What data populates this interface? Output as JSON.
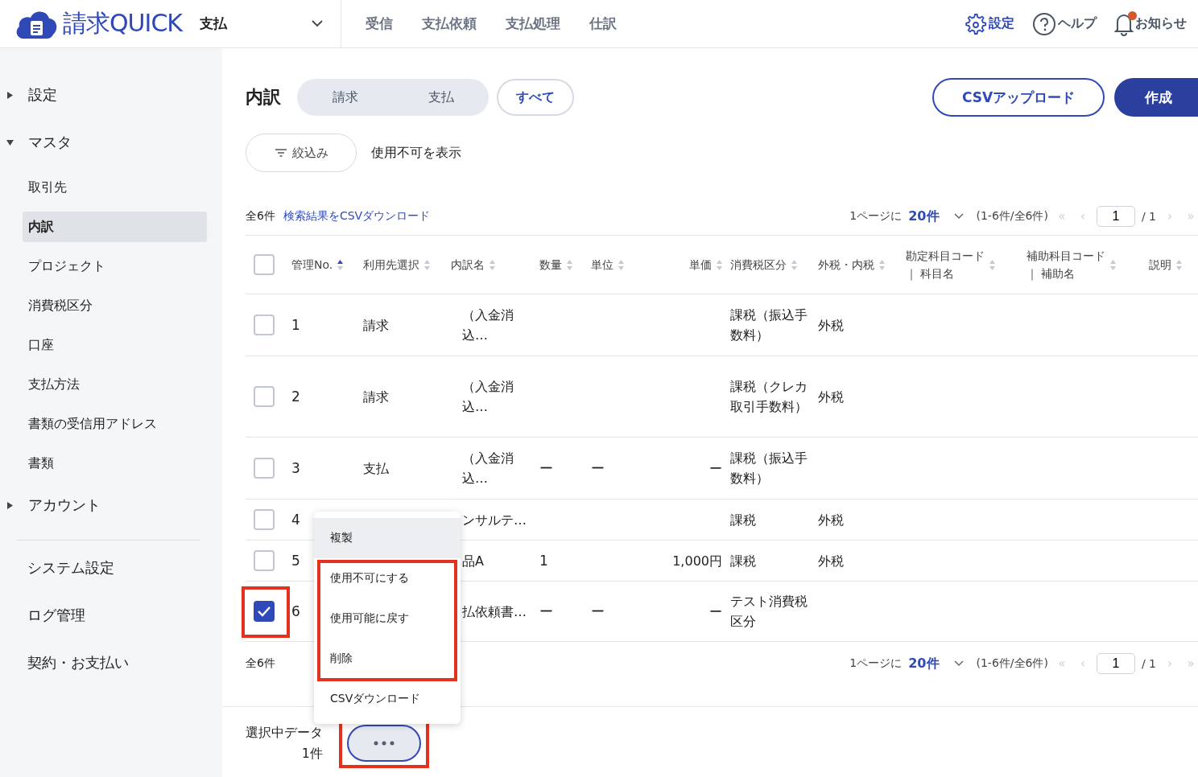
{
  "header": {
    "logo": "請求QUICK",
    "module": "支払",
    "nav": [
      {
        "label": "受信"
      },
      {
        "label": "支払依頼"
      },
      {
        "label": "支払処理"
      },
      {
        "label": "仕訳"
      }
    ],
    "settings": "設定",
    "help": "ヘルプ",
    "notifications": {
      "label": "お知らせ",
      "unread": true
    }
  },
  "sidebar": {
    "groups": [
      {
        "label": "設定",
        "expanded": false
      },
      {
        "label": "マスタ",
        "expanded": true,
        "children": [
          {
            "label": "取引先",
            "selected": false
          },
          {
            "label": "内訳",
            "selected": true
          },
          {
            "label": "プロジェクト",
            "selected": false
          },
          {
            "label": "消費税区分",
            "selected": false
          },
          {
            "label": "口座",
            "selected": false
          },
          {
            "label": "支払方法",
            "selected": false
          },
          {
            "label": "書類の受信用アドレス",
            "selected": false
          },
          {
            "label": "書類",
            "selected": false
          }
        ]
      },
      {
        "label": "アカウント",
        "expanded": false
      }
    ],
    "links": [
      "システム設定",
      "ログ管理",
      "契約・お支払い"
    ]
  },
  "page": {
    "title": "内訳",
    "filter_tabs": [
      {
        "label": "請求",
        "selected": false
      },
      {
        "label": "支払",
        "selected": false
      },
      {
        "label": "すべて",
        "selected": true
      }
    ],
    "upload_button": "CSVアップロード",
    "create_button": "作成",
    "filter_button": "絞込み",
    "show_disabled": "使用不可を表示"
  },
  "table": {
    "total": "全6件",
    "csv_link": "検索結果をCSVダウンロード",
    "pagination_top": {
      "per_page_label": "1ページに",
      "per_page": "20件",
      "range": "(1-6件/全6件)",
      "first": "«",
      "prev": "‹",
      "page": "1",
      "of": "/ 1",
      "next": "›",
      "last": "»"
    },
    "select_all": {
      "checked": false
    },
    "columns": [
      {
        "label": "管理No.",
        "sorted": true
      },
      {
        "label": "利用先選択",
        "sorted": false
      },
      {
        "label": "内訳名",
        "sorted": false
      },
      {
        "label": "数量",
        "sorted": false
      },
      {
        "label": "単位",
        "sorted": false
      },
      {
        "label": "単価",
        "sorted": false
      },
      {
        "label": "消費税区分",
        "sorted": false
      },
      {
        "label": "外税・内税",
        "sorted": false
      },
      {
        "label": "勘定科目コード",
        "sublabel": "｜ 科目名",
        "sorted": false
      },
      {
        "label": "補助科目コード",
        "sublabel": "｜ 補助名",
        "sorted": false
      },
      {
        "label": "説明",
        "sorted": false
      }
    ],
    "rows": [
      {
        "checked": false,
        "highlighted": false,
        "cells": [
          "1",
          "請求",
          "（入金消込…",
          "",
          "",
          "",
          "課税（振込手数料）",
          "外税",
          "",
          "",
          ""
        ]
      },
      {
        "checked": false,
        "highlighted": false,
        "cells": [
          "2",
          "請求",
          "（入金消込…",
          "",
          "",
          "",
          "課税（クレカ取引手数料）",
          "外税",
          "",
          "",
          ""
        ]
      },
      {
        "checked": false,
        "highlighted": false,
        "cells": [
          "3",
          "支払",
          "（入金消込…",
          "ー",
          "ー",
          "ー",
          "課税（振込手数料）",
          "",
          "",
          "",
          ""
        ]
      },
      {
        "checked": false,
        "highlighted": false,
        "cells": [
          "4",
          "",
          "ンサルテ…",
          "",
          "",
          "",
          "課税",
          "外税",
          "",
          "",
          ""
        ]
      },
      {
        "checked": false,
        "highlighted": false,
        "cells": [
          "5",
          "",
          "品A",
          "1",
          "",
          "1,000円",
          "課税",
          "外税",
          "",
          "",
          ""
        ]
      },
      {
        "checked": true,
        "highlighted": true,
        "cells": [
          "6",
          "",
          "払依頼書…",
          "ー",
          "ー",
          "ー",
          "テスト消費税区分",
          "",
          "",
          "",
          ""
        ]
      }
    ],
    "footer_total": "全6件",
    "pagination_bottom": {
      "per_page_label": "1ページに",
      "per_page": "20件",
      "range": "(1-6件/全6件)",
      "first": "«",
      "prev": "‹",
      "page": "1",
      "of": "/ 1",
      "next": "›",
      "last": "»"
    }
  },
  "context_menu": {
    "sections": [
      {
        "highlighted": false,
        "items": [
          {
            "label": "複製",
            "hovered": true
          }
        ]
      },
      {
        "highlighted": true,
        "items": [
          {
            "label": "使用不可にする",
            "hovered": false
          },
          {
            "label": "使用可能に戻す",
            "hovered": false
          },
          {
            "label": "削除",
            "hovered": false
          }
        ]
      },
      {
        "highlighted": false,
        "items": [
          {
            "label": "CSVダウンロード",
            "hovered": false
          }
        ]
      }
    ]
  },
  "selection_bar": {
    "label": "選択中データ",
    "count": "1件",
    "more_button": {
      "highlighted": true
    }
  }
}
